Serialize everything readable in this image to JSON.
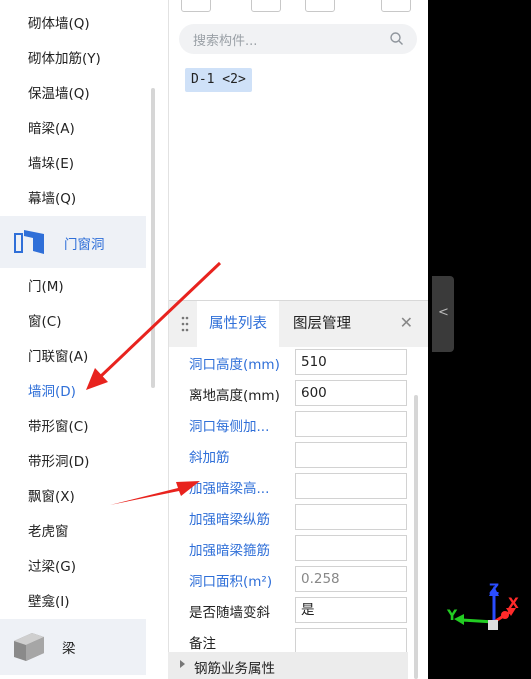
{
  "nav": {
    "items_top": [
      {
        "id": "masonry-wall",
        "label": "砌体墙(Q)"
      },
      {
        "id": "masonry-rebar",
        "label": "砌体加筋(Y)"
      },
      {
        "id": "insulation-wall",
        "label": "保温墙(Q)"
      },
      {
        "id": "concealed-beam",
        "label": "暗梁(A)"
      },
      {
        "id": "wall-pier",
        "label": "墙垛(E)"
      },
      {
        "id": "curtain-wall",
        "label": "幕墙(Q)"
      }
    ],
    "category_doors": {
      "label": "门窗洞"
    },
    "items_doors": [
      {
        "id": "door",
        "label": "门(M)"
      },
      {
        "id": "window",
        "label": "窗(C)"
      },
      {
        "id": "door-window",
        "label": "门联窗(A)"
      },
      {
        "id": "wall-opening",
        "label": "墙洞(D)",
        "active": true
      },
      {
        "id": "strip-window",
        "label": "带形窗(C)"
      },
      {
        "id": "strip-opening",
        "label": "带形洞(D)"
      },
      {
        "id": "bay-window",
        "label": "飘窗(X)"
      },
      {
        "id": "dormer",
        "label": "老虎窗"
      },
      {
        "id": "lintel",
        "label": "过梁(G)"
      },
      {
        "id": "niche",
        "label": "壁龛(I)"
      }
    ],
    "category_beam": {
      "label": "梁"
    }
  },
  "search": {
    "placeholder": "搜索构件..."
  },
  "component_tag": "D-1 <2>",
  "props": {
    "tab_active": "属性列表",
    "tab_other": "图层管理",
    "close": "✕",
    "rows": [
      {
        "id": "opening-height",
        "label": "洞口高度(mm)",
        "value": "510",
        "link": true,
        "readonly": false
      },
      {
        "id": "sill-height",
        "label": "离地高度(mm)",
        "value": "600",
        "link": false,
        "readonly": false
      },
      {
        "id": "side-rebar",
        "label": "洞口每侧加...",
        "value": "",
        "link": true,
        "readonly": false
      },
      {
        "id": "diagonal-rebar",
        "label": "斜加筋",
        "value": "",
        "link": true,
        "readonly": false
      },
      {
        "id": "reinforced-beam-height",
        "label": "加强暗梁高...",
        "value": "",
        "link": true,
        "readonly": false
      },
      {
        "id": "reinforced-beam-long",
        "label": "加强暗梁纵筋",
        "value": "",
        "link": true,
        "readonly": false
      },
      {
        "id": "reinforced-beam-stirrup",
        "label": "加强暗梁箍筋",
        "value": "",
        "link": true,
        "readonly": false
      },
      {
        "id": "opening-area",
        "label": "洞口面积(m²)",
        "value": "0.258",
        "link": true,
        "readonly": true
      },
      {
        "id": "follow-slope",
        "label": "是否随墙变斜",
        "value": "是",
        "link": false,
        "readonly": false
      },
      {
        "id": "remark",
        "label": "备注",
        "value": "",
        "link": false,
        "readonly": false
      }
    ],
    "group": "钢筋业务属性"
  },
  "axis_gizmo": {
    "x": "X",
    "y": "Y",
    "z": "Z"
  },
  "colors": {
    "accent": "#2f6fd8",
    "arrow": "#e8231e"
  }
}
